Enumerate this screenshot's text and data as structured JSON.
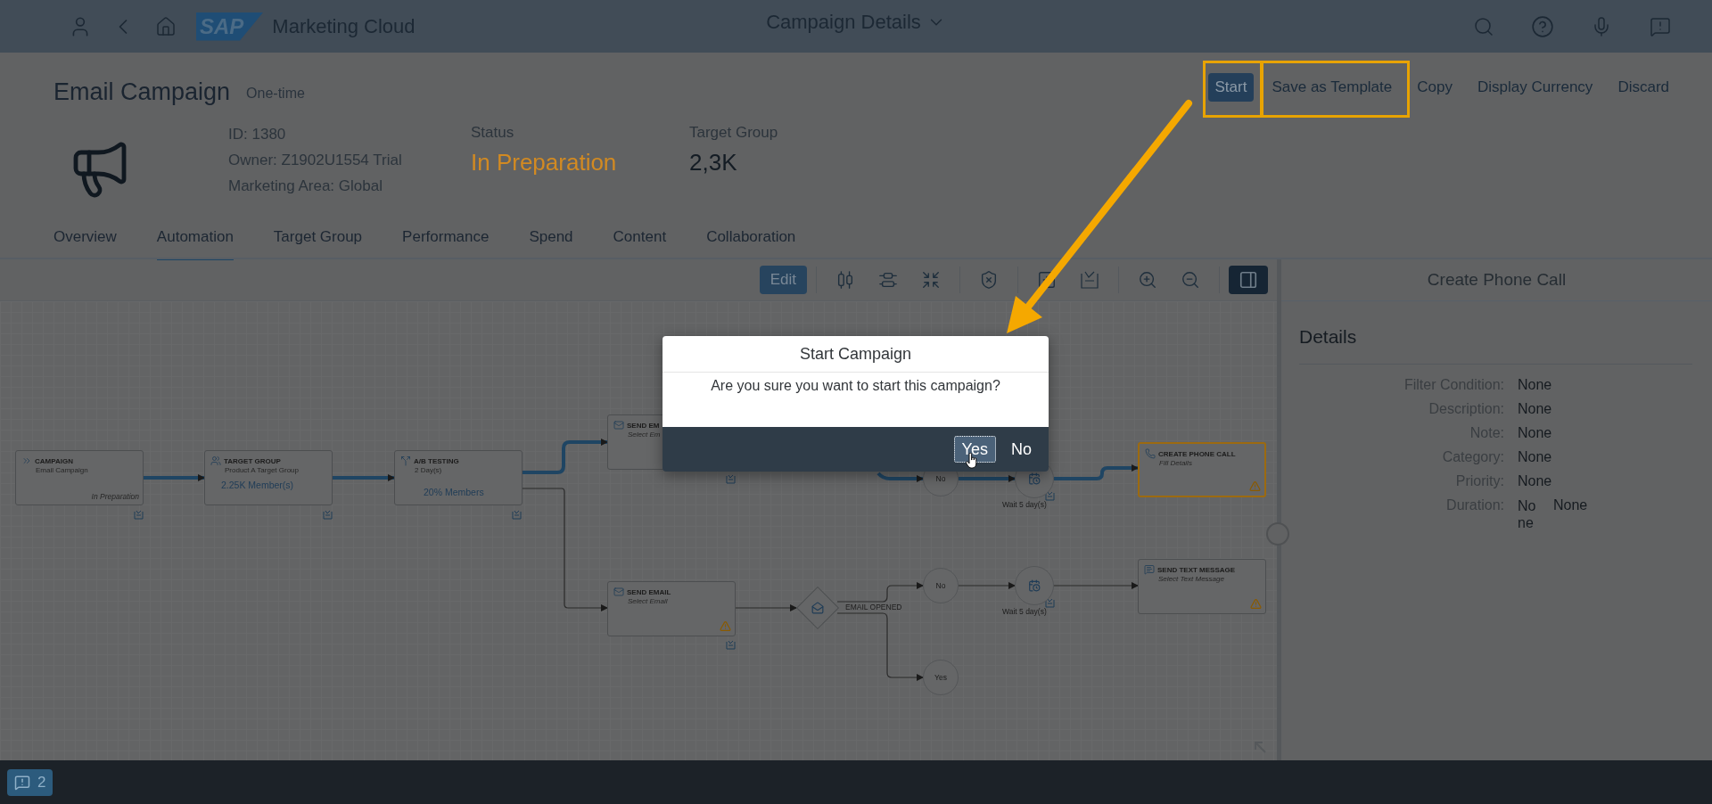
{
  "shell": {
    "logo": "SAP",
    "app_title": "Marketing Cloud",
    "page_title": "Campaign Details"
  },
  "header": {
    "title": "Email Campaign",
    "subtitle": "One-time",
    "actions": [
      {
        "label": "Start",
        "kind": "emphasized",
        "highlighted": true
      },
      {
        "label": "Save as Template",
        "kind": "transparent",
        "highlighted": true
      },
      {
        "label": "Copy",
        "kind": "transparent",
        "highlighted": false
      },
      {
        "label": "Display Currency",
        "kind": "transparent",
        "highlighted": false
      },
      {
        "label": "Discard",
        "kind": "transparent",
        "highlighted": false
      }
    ],
    "attributes": [
      {
        "label": "ID:",
        "value": "1380"
      },
      {
        "label": "Owner:",
        "value": "Z1902U1554 Trial"
      },
      {
        "label": "Marketing Area:",
        "value": "Global"
      }
    ],
    "kpis": [
      {
        "label": "Status",
        "value": "In Preparation",
        "kind": "status"
      },
      {
        "label": "Target Group",
        "value": "2,3K",
        "kind": "number"
      }
    ]
  },
  "tabs": [
    {
      "label": "Overview",
      "selected": false
    },
    {
      "label": "Automation",
      "selected": true
    },
    {
      "label": "Target Group",
      "selected": false
    },
    {
      "label": "Performance",
      "selected": false
    },
    {
      "label": "Spend",
      "selected": false
    },
    {
      "label": "Content",
      "selected": false
    },
    {
      "label": "Collaboration",
      "selected": false
    }
  ],
  "toolbar": {
    "edit_label": "Edit",
    "panel_toggle_selected": true
  },
  "flow": {
    "nodes": [
      {
        "kind": "campaign",
        "title": "CAMPAIGN",
        "subtitle": "Email Campaign",
        "status": "In Preparation",
        "warning": false,
        "selected": false
      },
      {
        "kind": "target_group",
        "title": "TARGET GROUP",
        "subtitle": "Product A Target Group",
        "detail": "2.25K Member(s)",
        "warning": false,
        "selected": false
      },
      {
        "kind": "ab_testing",
        "title": "A/B TESTING",
        "subtitle": "2 Day(s)",
        "detail": "20% Members",
        "warning": false,
        "selected": false
      },
      {
        "kind": "send_email",
        "title": "SEND EM",
        "subtitle": "Select Em",
        "warning": false,
        "selected": false
      },
      {
        "kind": "send_email",
        "title": "SEND EMAIL",
        "subtitle": "Select Email",
        "warning": true,
        "selected": false
      },
      {
        "kind": "phone_call",
        "title": "CREATE PHONE CALL",
        "subtitle": "Fill Details",
        "warning": true,
        "selected": true
      },
      {
        "kind": "text_message",
        "title": "SEND TEXT MESSAGE",
        "subtitle": "Select Text Message",
        "warning": true,
        "selected": false
      }
    ],
    "decision": {
      "label": "EMAIL OPENED"
    },
    "outcomes": [
      {
        "label": "No"
      },
      {
        "label": "No"
      },
      {
        "label": "Yes"
      }
    ],
    "waits": [
      {
        "caption": "Wait 5 day(s)"
      },
      {
        "caption": "Wait 5 day(s)"
      }
    ]
  },
  "side_panel": {
    "title": "Create Phone Call",
    "section": "Details",
    "fields": [
      {
        "label": "Filter Condition:",
        "values": [
          "None"
        ]
      },
      {
        "label": "Description:",
        "values": [
          "None"
        ]
      },
      {
        "label": "Note:",
        "values": [
          "None"
        ]
      },
      {
        "label": "Category:",
        "values": [
          "None"
        ]
      },
      {
        "label": "Priority:",
        "values": [
          "None"
        ]
      },
      {
        "label": "Duration:",
        "values": [
          "None",
          "None"
        ]
      }
    ]
  },
  "dialog": {
    "title": "Start Campaign",
    "message": "Are you sure you want to start this campaign?",
    "buttons": [
      {
        "label": "Yes",
        "focused": true
      },
      {
        "label": "No",
        "focused": false
      }
    ]
  },
  "footer": {
    "message_count": "2"
  }
}
